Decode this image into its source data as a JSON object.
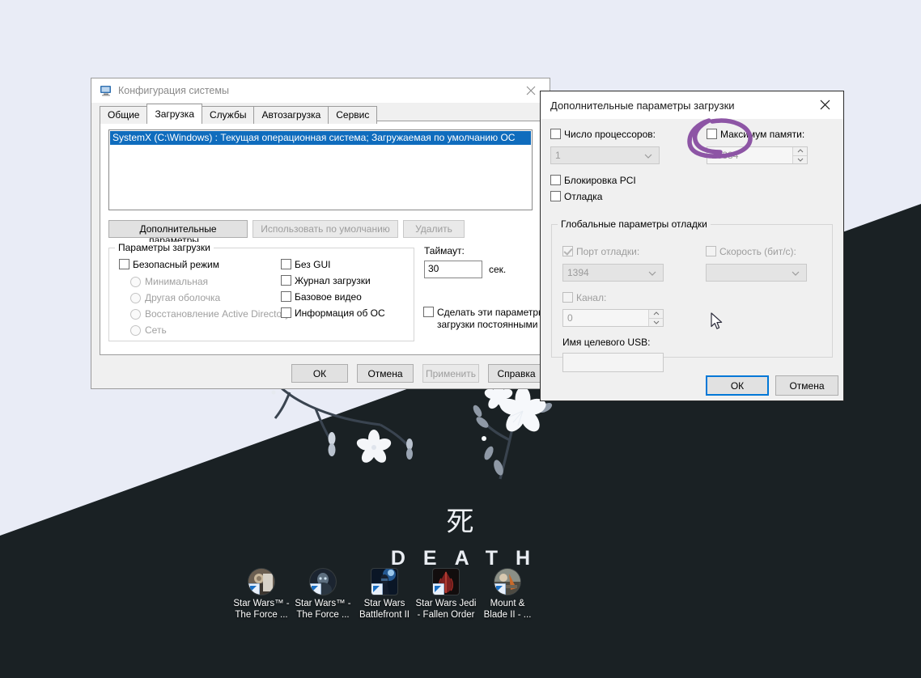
{
  "desktop": {
    "wallpaper": {
      "kanji": "死",
      "word": "DEATH",
      "light_color": "#e9ecf6",
      "dark_color": "#1a2124"
    },
    "icons": [
      {
        "label": "Star Wars™ -\nThe Force ...",
        "name": "star-wars-force-unleashed-1"
      },
      {
        "label": "Star Wars™ -\nThe Force ...",
        "name": "star-wars-force-unleashed-2"
      },
      {
        "label": "Star Wars\nBattlefront II",
        "name": "star-wars-battlefront-2"
      },
      {
        "label": "Star Wars Jedi\n- Fallen Order",
        "name": "star-wars-jedi-fallen-order"
      },
      {
        "label": "Mount &\nBlade II - ...",
        "name": "mount-and-blade-2"
      }
    ]
  },
  "msconfig": {
    "title": "Конфигурация системы",
    "close_label": "✕",
    "tabs": [
      {
        "label": "Общие",
        "active": false
      },
      {
        "label": "Загрузка",
        "active": true
      },
      {
        "label": "Службы",
        "active": false
      },
      {
        "label": "Автозагрузка",
        "active": false
      },
      {
        "label": "Сервис",
        "active": false
      }
    ],
    "os_entry": "SystemX (C:\\Windows) : Текущая операционная система; Загружаемая по умолчанию ОС",
    "buttons": {
      "advanced": "Дополнительные параметры...",
      "use_default": "Использовать по умолчанию",
      "delete": "Удалить"
    },
    "boot_options": {
      "group_title": "Параметры загрузки",
      "safe_mode": "Безопасный режим",
      "radios": [
        "Минимальная",
        "Другая оболочка",
        "Восстановление Active Directory",
        "Сеть"
      ],
      "checks": [
        "Без GUI",
        "Журнал загрузки",
        "Базовое видео",
        "Информация  об ОС"
      ]
    },
    "timeout": {
      "label": "Таймаут:",
      "value": "30",
      "unit": "сек."
    },
    "make_permanent": "Сделать эти параметры загрузки постоянными",
    "footer": {
      "ok": "ОК",
      "cancel": "Отмена",
      "apply": "Применить",
      "help": "Справка"
    }
  },
  "advanced_dialog": {
    "title": "Дополнительные параметры загрузки",
    "close_label": "✕",
    "cpu_count": {
      "label": "Число процессоров:",
      "value": "1",
      "checked": false
    },
    "max_memory": {
      "label": "Максимум памяти:",
      "value": "16384",
      "checked": false
    },
    "pci_lock": "Блокировка PCI",
    "debug": "Отладка",
    "debug_group": {
      "title": "Глобальные параметры отладки",
      "debug_port": {
        "label": "Порт отладки:",
        "value": "1394",
        "checked": true
      },
      "baud_rate": {
        "label": "Скорость (бит/с):",
        "value": "",
        "checked": false
      },
      "channel": {
        "label": "Канал:",
        "value": "0",
        "checked": false
      },
      "usb_target": {
        "label": "Имя целевого USB:",
        "value": ""
      }
    },
    "footer": {
      "ok": "ОК",
      "cancel": "Отмена"
    }
  },
  "annotation": {
    "shape": "hand-drawn-ellipse",
    "color": "#8d55a5",
    "targets": "max-memory-checkbox"
  }
}
